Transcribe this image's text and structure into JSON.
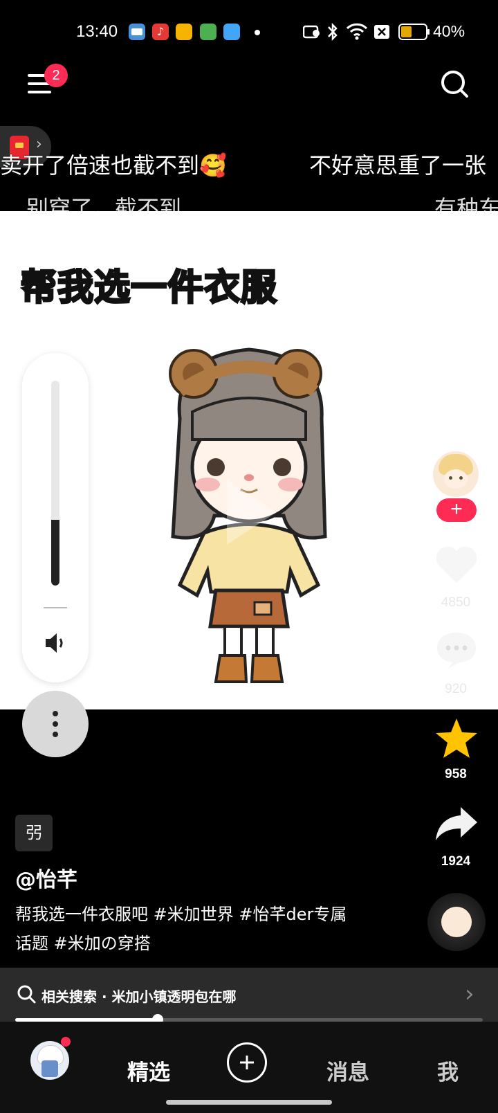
{
  "status_bar": {
    "time": "13:40",
    "battery": "40%"
  },
  "top_bar": {
    "menu_badge": "2"
  },
  "danmaku": [
    {
      "text": "卖开了倍速也截不到🥰"
    },
    {
      "text": "不好意思重了一张"
    },
    {
      "text": "别穿了，截不到"
    },
    {
      "text": "有种东"
    }
  ],
  "video": {
    "overlay_title": "帮我选一件衣服"
  },
  "volume": {
    "level": 0.32
  },
  "rail": {
    "likes": "4850",
    "comments": "920",
    "favorites": "958",
    "shares": "1924",
    "favorite_color": "#ffc300"
  },
  "info": {
    "tag": "弜",
    "author": "@怡芊",
    "description": "帮我选一件衣服吧 #米加世界 #怡芊der专属话题 #米加の穿搭"
  },
  "related_search": {
    "label": "相关搜索 · 米加小镇透明包在哪"
  },
  "progress": {
    "value": 0.305
  },
  "nav": {
    "featured": "精选",
    "messages": "消息",
    "me": "我"
  },
  "colors": {
    "accent": "#fe2c55"
  }
}
